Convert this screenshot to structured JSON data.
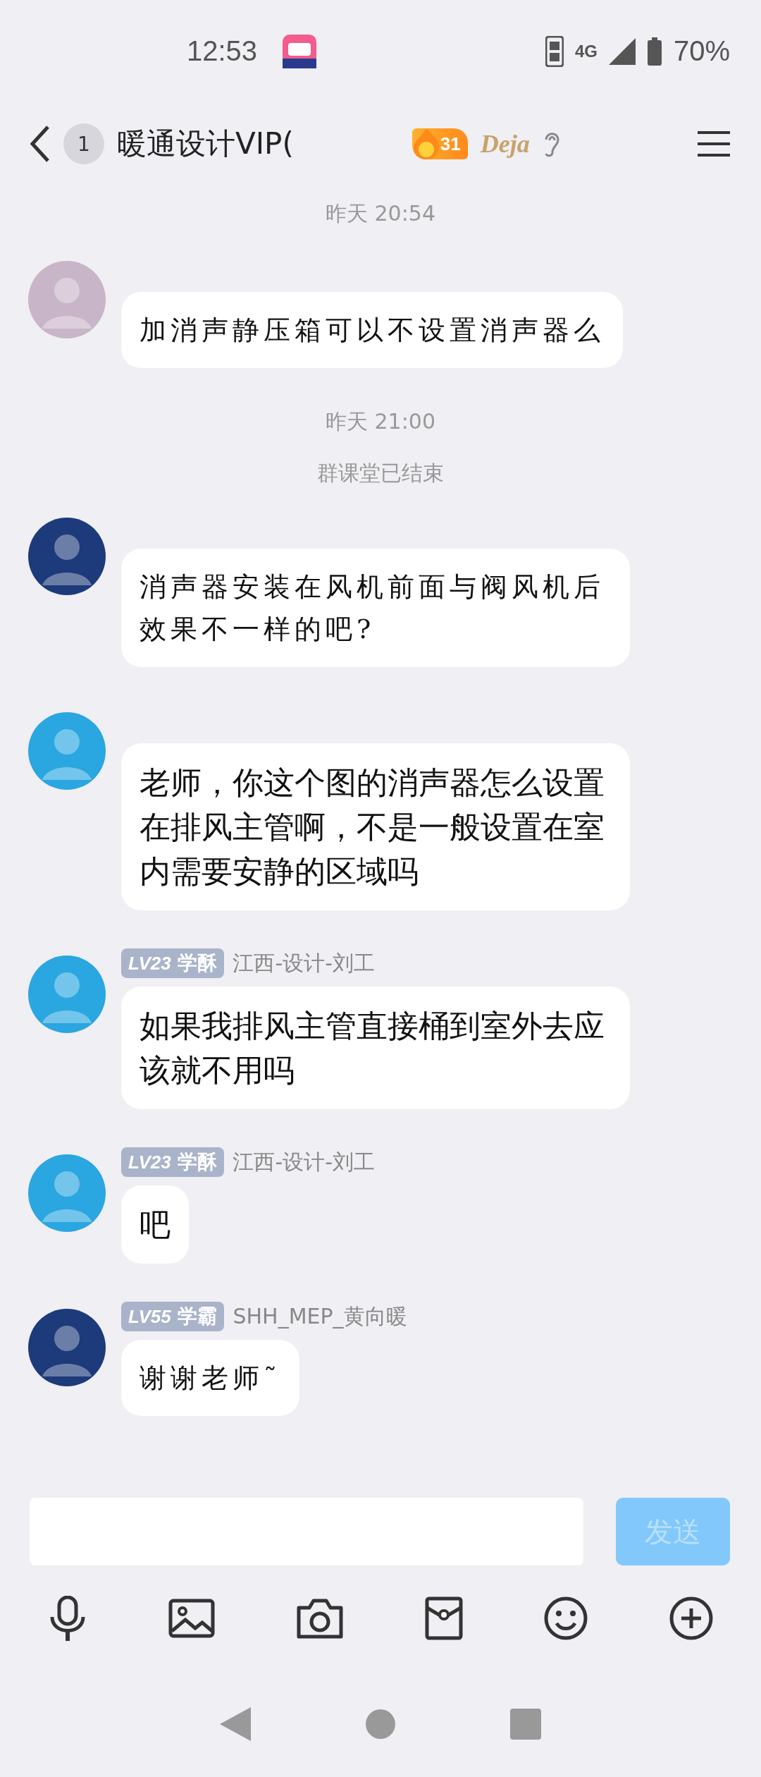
{
  "status_bar": {
    "time": "12:53",
    "network": "4G",
    "battery": "70%"
  },
  "header": {
    "unread": "1",
    "title": "暖通设计VIP(",
    "streak": "31",
    "logo": "Deja"
  },
  "chat": [
    {
      "kind": "time",
      "text": "昨天 20:54"
    },
    {
      "kind": "handwritten",
      "color": "#c9b5c8",
      "text": "加消声静压箱可以不设置消声器么"
    },
    {
      "kind": "time",
      "text": "昨天 21:00"
    },
    {
      "kind": "notice",
      "text": "群课堂已结束"
    },
    {
      "kind": "handwritten",
      "color": "#1d3a7a",
      "text": "消声器安装在风机前面与阀风机后效果不一样的吧?"
    },
    {
      "kind": "plain",
      "color": "#2aa6e0",
      "text": "老师，你这个图的消声器怎么设置在排风主管啊，不是一般设置在室内需要安静的区域吗"
    },
    {
      "kind": "plain",
      "color": "#2aa6e0",
      "rank": "LV23",
      "title": "学酥",
      "name": "江西-设计-刘工",
      "text": "如果我排风主管直接桶到室外去应该就不用吗"
    },
    {
      "kind": "plain",
      "color": "#2aa6e0",
      "rank": "LV23",
      "title": "学酥",
      "name": "江西-设计-刘工",
      "text": "吧"
    },
    {
      "kind": "handwritten",
      "color": "#1d3a7a",
      "rank": "LV55",
      "title": "学霸",
      "name": "SHH_MEP_黄向暖",
      "text": "谢谢老师˜"
    }
  ],
  "composer": {
    "send": "发送",
    "send_enabled": false
  }
}
